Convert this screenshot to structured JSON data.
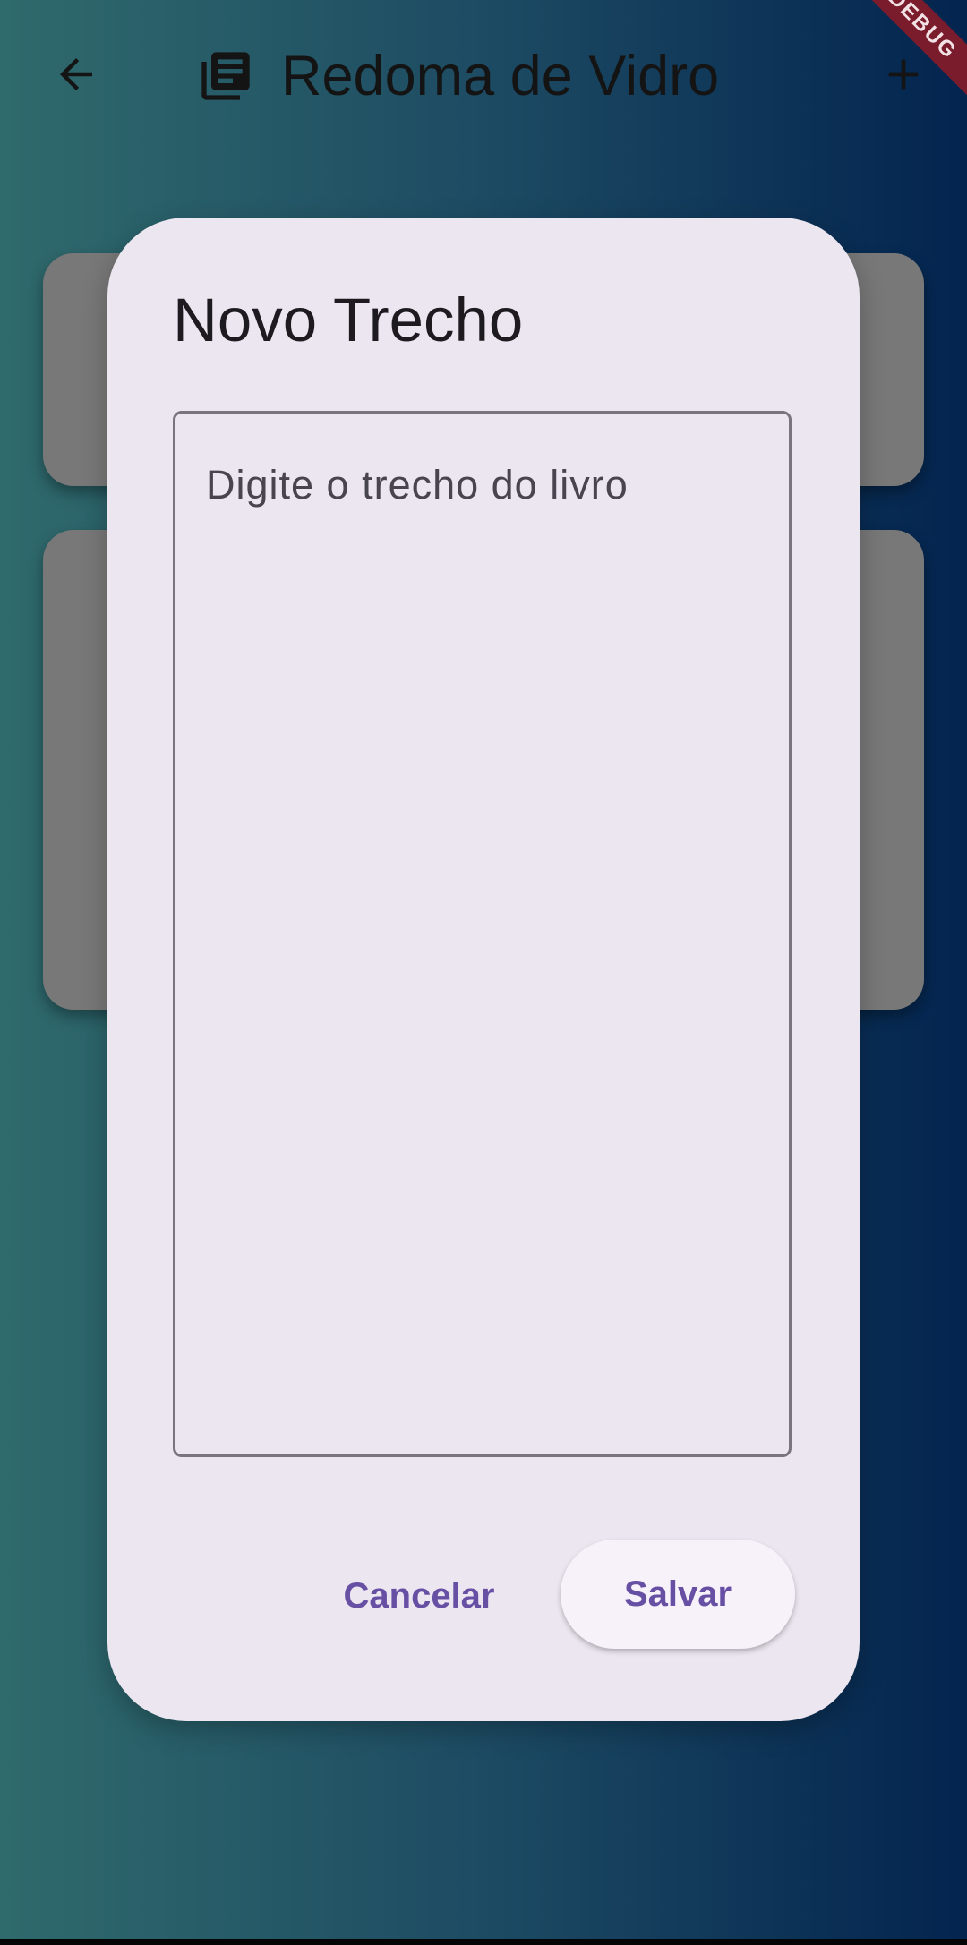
{
  "app_bar": {
    "title": "Redoma de Vidro",
    "back_icon": "arrow-back-icon",
    "title_icon": "library-books-icon",
    "add_icon": "add-icon"
  },
  "debug_banner": {
    "label": "DEBUG",
    "color": "#7a1c2b"
  },
  "dialog": {
    "title": "Novo Trecho",
    "text_field": {
      "placeholder": "Digite o trecho do livro",
      "value": ""
    },
    "cancel_label": "Cancelar",
    "save_label": "Salvar"
  },
  "colors": {
    "accent": "#6750a4",
    "dialog_surface": "#ece6f0",
    "card": "#787878",
    "gradient_start": "#2f6a6c",
    "gradient_end": "#01224f"
  }
}
